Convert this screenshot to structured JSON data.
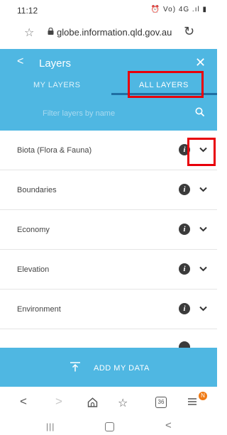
{
  "status_bar": {
    "time": "11:12",
    "indicators": "⏰ Vo) 4G .ıl ▮"
  },
  "address_bar": {
    "url": "globe.information.qld.gov.au"
  },
  "panel": {
    "back_symbol": "<",
    "title": "Layers",
    "close_symbol": "✕",
    "tabs": [
      {
        "label": "MY LAYERS",
        "active": false
      },
      {
        "label": "ALL LAYERS",
        "active": true
      }
    ],
    "filter_placeholder": "Filter layers by name"
  },
  "layers": [
    {
      "label": "Biota (Flora & Fauna)"
    },
    {
      "label": "Boundaries"
    },
    {
      "label": "Economy"
    },
    {
      "label": "Elevation"
    },
    {
      "label": "Environment"
    }
  ],
  "info_glyph": "i",
  "add_data": {
    "label": "ADD MY DATA"
  },
  "browser_nav": {
    "tabs_count": "36",
    "notification": "N"
  },
  "colors": {
    "accent": "#4fb7e2",
    "tab_underline": "#1f6fa3",
    "highlight": "#e8000a",
    "badge": "#f07a14"
  }
}
